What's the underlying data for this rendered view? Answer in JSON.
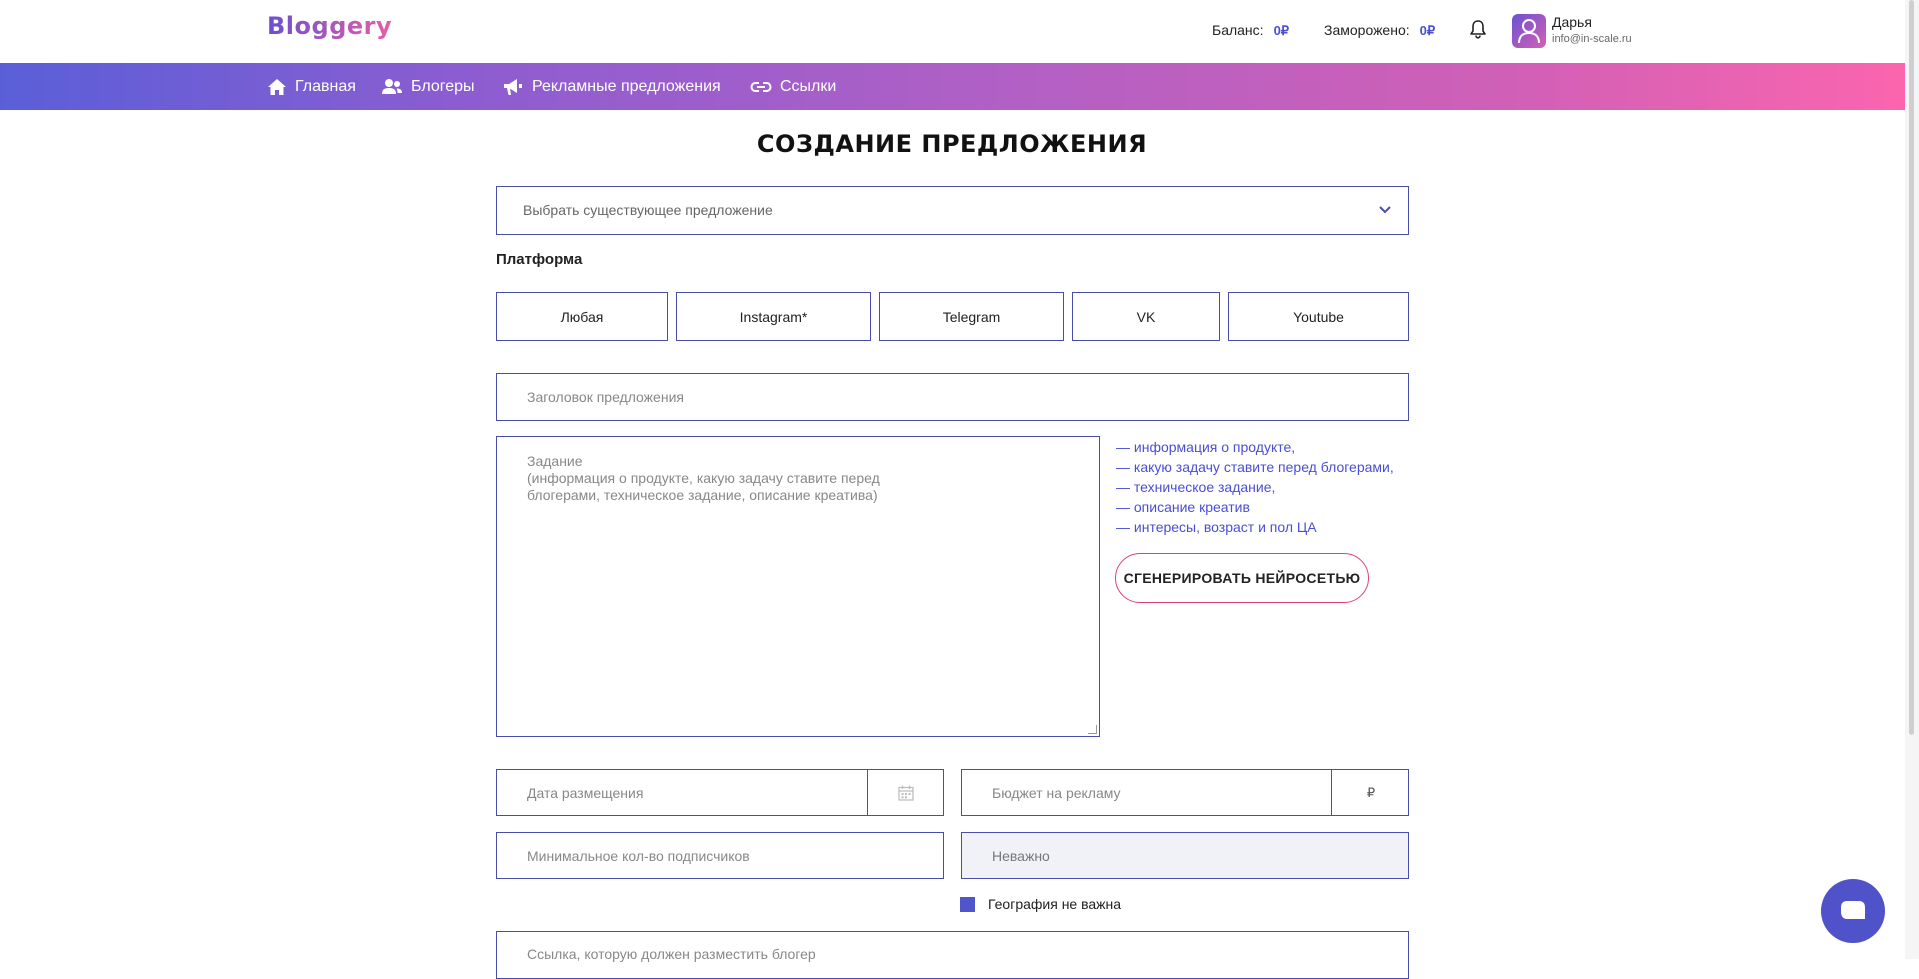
{
  "header": {
    "logo": "Bloggery",
    "balance_label": "Баланс:",
    "balance_value": "0₽",
    "frozen_label": "Заморожено:",
    "frozen_value": "0₽",
    "user_name": "Дарья",
    "user_email": "info@in-scale.ru"
  },
  "nav": {
    "items": [
      {
        "label": "Главная",
        "icon": "home-icon"
      },
      {
        "label": "Блогеры",
        "icon": "users-icon"
      },
      {
        "label": "Рекламные предложения",
        "icon": "megaphone-icon"
      },
      {
        "label": "Ссылки",
        "icon": "link-icon"
      }
    ]
  },
  "form": {
    "title": "СОЗДАНИЕ ПРЕДЛОЖЕНИЯ",
    "existing_offer_placeholder": "Выбрать существующее предложение",
    "platform_label": "Платформа",
    "platforms": [
      "Любая",
      "Instagram*",
      "Telegram",
      "VK",
      "Youtube"
    ],
    "offer_title_placeholder": "Заголовок предложения",
    "task_placeholder": "Задание\n(информация о продукте, какую задачу ставите перед\nблогерами, техническое задание, описание креатива)",
    "hints": [
      "— информация о продукте,",
      "— какую задачу ставите перед блогерами,",
      "— техническое задание,",
      "— описание креатив",
      "— интересы, возраст и пол ЦА"
    ],
    "generate_button": "СГЕНЕРИРОВАТЬ НЕЙРОСЕТЬЮ",
    "date_placeholder": "Дата размещения",
    "budget_placeholder": "Бюджет на рекламу",
    "currency": "₽",
    "min_subscribers_placeholder": "Минимальное кол-во подписчиков",
    "geo_select_value": "Неважно",
    "geo_checkbox_label": "География не важна",
    "geo_checkbox_checked": true,
    "link_placeholder": "Ссылка, которую должен разместить блогер"
  },
  "colors": {
    "accent": "#4a4ed6",
    "border": "#4a4ea8",
    "gradient_start": "#5a5fd8",
    "gradient_end": "#fb65ae",
    "generate_border": "#e0407a"
  }
}
